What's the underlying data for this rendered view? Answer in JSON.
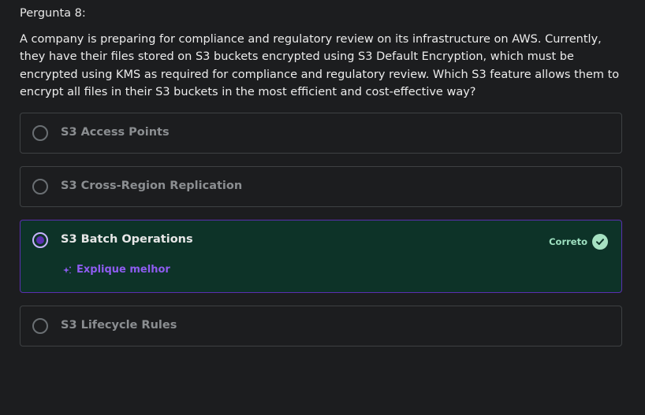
{
  "question": {
    "label": "Pergunta 8:",
    "text": "A company is preparing for compliance and regulatory review on its infrastructure on AWS. Currently, they have their files stored on S3 buckets encrypted using S3 Default Encryption, which must be encrypted using KMS as required for compliance and regulatory review. Which S3 feature allows them to encrypt all files in their S3 buckets in the most efficient and cost-effective way?"
  },
  "options": [
    {
      "label": "S3 Access Points",
      "selected": false
    },
    {
      "label": "S3 Cross-Region Replication",
      "selected": false
    },
    {
      "label": "S3 Batch Operations",
      "selected": true,
      "status": "Correto",
      "explain_label": "Explique melhor"
    },
    {
      "label": "S3 Lifecycle Rules",
      "selected": false
    }
  ],
  "colors": {
    "background": "#1c1d1f",
    "correct_bg": "#0d3328",
    "accent_purple": "#5a2fb0",
    "correct_green": "#a6e2c2"
  }
}
